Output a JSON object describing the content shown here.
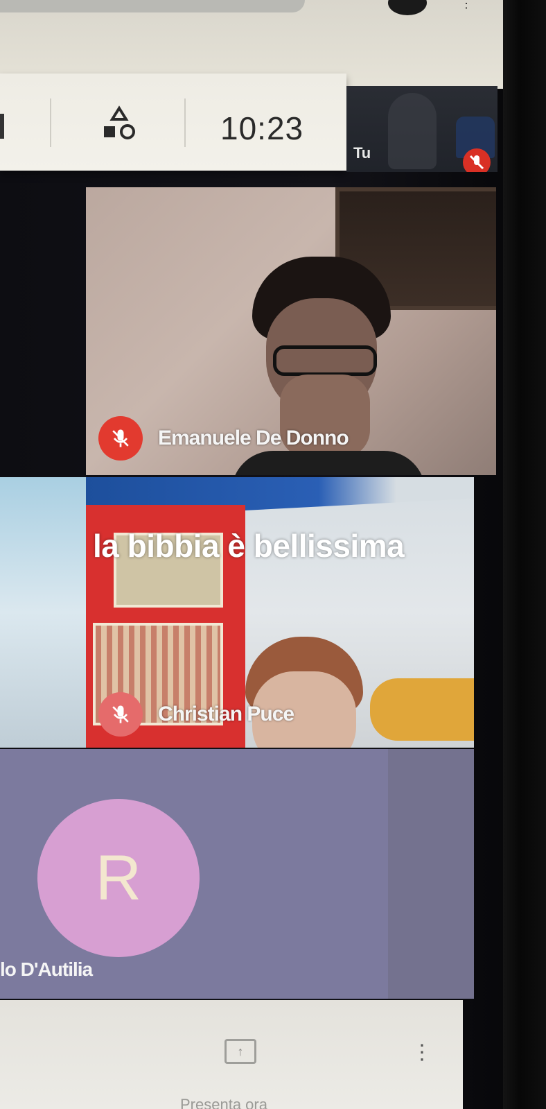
{
  "toolbar": {
    "clock": "10:23",
    "activities_icon": "shapes-icon"
  },
  "self_view": {
    "label": "Tu",
    "mic_status": "muted"
  },
  "participants": [
    {
      "name": "Emanuele De Donno",
      "mic_status": "muted"
    },
    {
      "name": "Christian Puce",
      "mic_status": "muted",
      "caption": "la bibbia è bellissima"
    },
    {
      "name": "lo D'Autilia",
      "avatar_letter": "R",
      "avatar_color": "#d79fd2"
    }
  ],
  "bottom_bar": {
    "present_label": "Presenta ora"
  },
  "colors": {
    "mic_muted": "#e23a2f",
    "toolbar_bg": "#eeece4"
  }
}
